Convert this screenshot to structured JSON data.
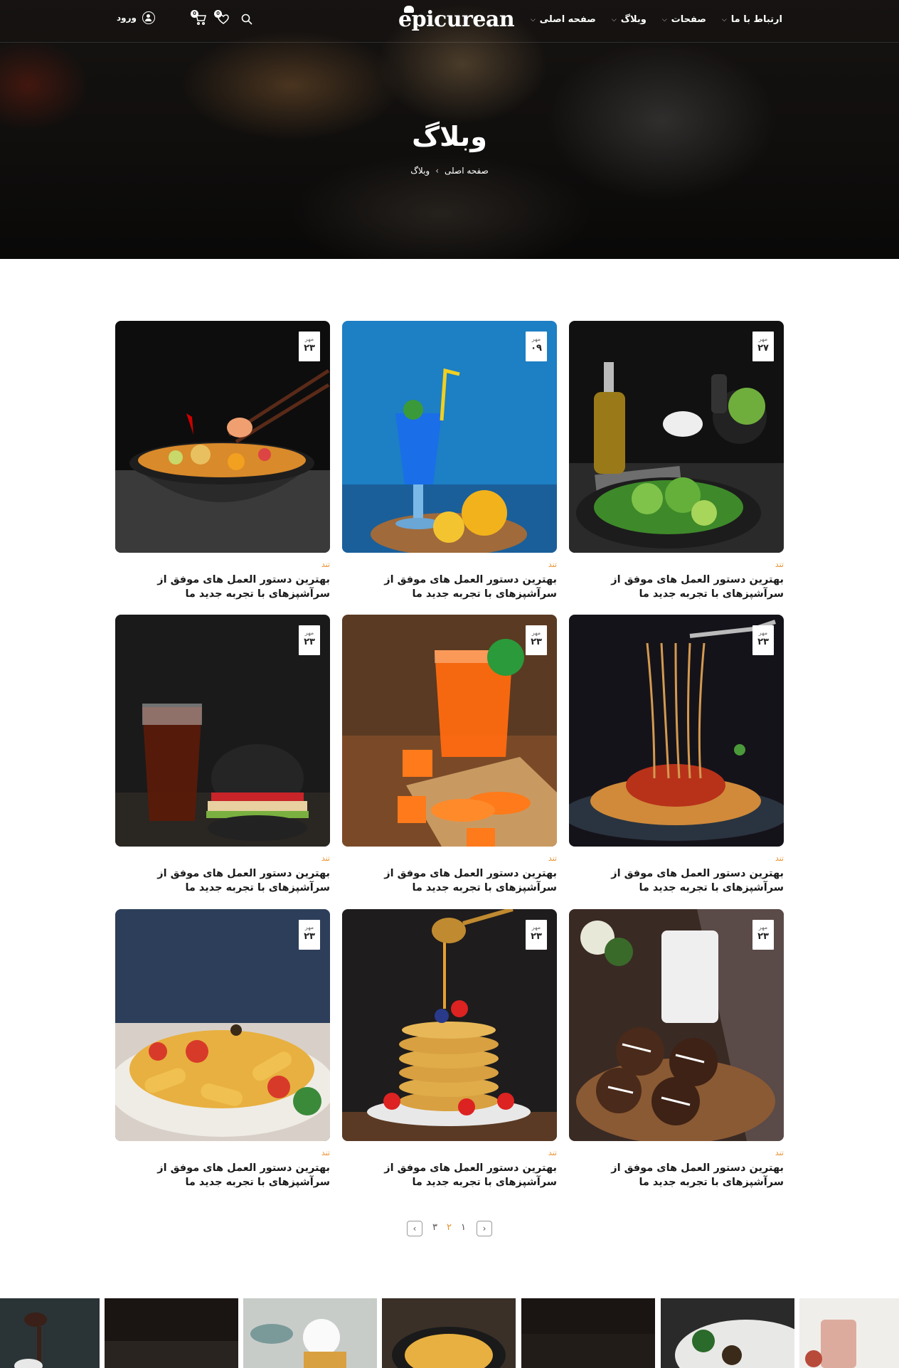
{
  "nav": {
    "logo": "epicurean",
    "menu": [
      {
        "label": "صفحه اصلی"
      },
      {
        "label": "وبلاگ"
      },
      {
        "label": "صفحات"
      },
      {
        "label": "ارتباط با ما"
      }
    ],
    "login_label": "ورود",
    "cart_count": "0",
    "wishlist_count": "0"
  },
  "hero": {
    "title": "وبلاگ",
    "breadcrumb": [
      "صفحه اصلی",
      "وبلاگ"
    ]
  },
  "posts": [
    {
      "month": "مهر",
      "day": "۲۷",
      "category": "تند",
      "title": "بهترین دستور العمل های موفق از سرآشپزهای با تجربه جدید ما",
      "image": "salad-icon"
    },
    {
      "month": "مهر",
      "day": "۰۹",
      "category": "تند",
      "title": "بهترین دستور العمل های موفق از سرآشپزهای با تجربه جدید ما",
      "image": "blue-drink-icon"
    },
    {
      "month": "مهر",
      "day": "۲۳",
      "category": "تند",
      "title": "بهترین دستور العمل های موفق از سرآشپزهای با تجربه جدید ما",
      "image": "noodle-bowl-icon"
    },
    {
      "month": "مهر",
      "day": "۲۳",
      "category": "تند",
      "title": "بهترین دستور العمل های موفق از سرآشپزهای با تجربه جدید ما",
      "image": "spaghetti-icon"
    },
    {
      "month": "مهر",
      "day": "۲۳",
      "category": "تند",
      "title": "بهترین دستور العمل های موفق از سرآشپزهای با تجربه جدید ما",
      "image": "carrot-juice-icon"
    },
    {
      "month": "مهر",
      "day": "۲۳",
      "category": "تند",
      "title": "بهترین دستور العمل های موفق از سرآشپزهای با تجربه جدید ما",
      "image": "burger-cola-icon"
    },
    {
      "month": "مهر",
      "day": "۲۳",
      "category": "تند",
      "title": "بهترین دستور العمل های موفق از سرآشپزهای با تجربه جدید ما",
      "image": "milk-cookies-icon"
    },
    {
      "month": "مهر",
      "day": "۲۳",
      "category": "تند",
      "title": "بهترین دستور العمل های موفق از سرآشپزهای با تجربه جدید ما",
      "image": "pancakes-icon"
    },
    {
      "month": "مهر",
      "day": "۲۳",
      "category": "تند",
      "title": "بهترین دستور العمل های موفق از سرآشپزهای با تجربه جدید ما",
      "image": "pasta-icon"
    }
  ],
  "pagination": {
    "pages": [
      "۱",
      "۲",
      "۳"
    ],
    "current": "۲"
  },
  "colors": {
    "accent": "#e8912d",
    "hero_bg": "#151311"
  }
}
